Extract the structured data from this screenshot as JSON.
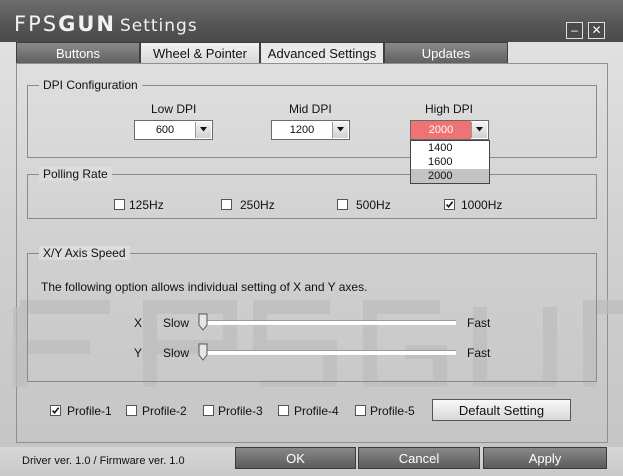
{
  "window": {
    "brand_regular": "FPS",
    "brand_bold": "GUN",
    "title": "Settings",
    "minimize_glyph": "–",
    "close_glyph": "✕"
  },
  "tabs": [
    {
      "label": "Buttons"
    },
    {
      "label": "Wheel & Pointer"
    },
    {
      "label": "Advanced Settings",
      "active": true
    },
    {
      "label": "Updates"
    }
  ],
  "dpi": {
    "title": "DPI Configuration",
    "low": {
      "label": "Low DPI",
      "value": "600"
    },
    "mid": {
      "label": "Mid DPI",
      "value": "1200"
    },
    "high": {
      "label": "High DPI",
      "value": "2000"
    },
    "dropdown_options": [
      "1400",
      "1600",
      "2000"
    ],
    "dropdown_selected": "2000",
    "highlight_color": "#ee7373"
  },
  "polling": {
    "title": "Polling Rate",
    "options": [
      {
        "label": "125Hz",
        "checked": false
      },
      {
        "label": "250Hz",
        "checked": false
      },
      {
        "label": "500Hz",
        "checked": false
      },
      {
        "label": "1000Hz",
        "checked": true
      }
    ]
  },
  "axis": {
    "title": "X/Y Axis Speed",
    "description": "The following option allows individual setting of X and Y axes.",
    "x": {
      "label": "X",
      "min_label": "Slow",
      "max_label": "Fast",
      "level": 0
    },
    "y": {
      "label": "Y",
      "min_label": "Slow",
      "max_label": "Fast",
      "level": 0
    }
  },
  "profiles": [
    {
      "label": "Profile-1",
      "checked": true
    },
    {
      "label": "Profile-2",
      "checked": false
    },
    {
      "label": "Profile-3",
      "checked": false
    },
    {
      "label": "Profile-4",
      "checked": false
    },
    {
      "label": "Profile-5",
      "checked": false
    }
  ],
  "buttons": {
    "default_setting": "Default Setting",
    "ok": "OK",
    "cancel": "Cancel",
    "apply": "Apply"
  },
  "status": {
    "version": "Driver ver. 1.0 / Firmware ver. 1.0"
  },
  "icons": {
    "dropdown_arrow": "chevron-down-icon",
    "check": "check-icon",
    "slider_thumb": "slider-thumb-icon"
  }
}
